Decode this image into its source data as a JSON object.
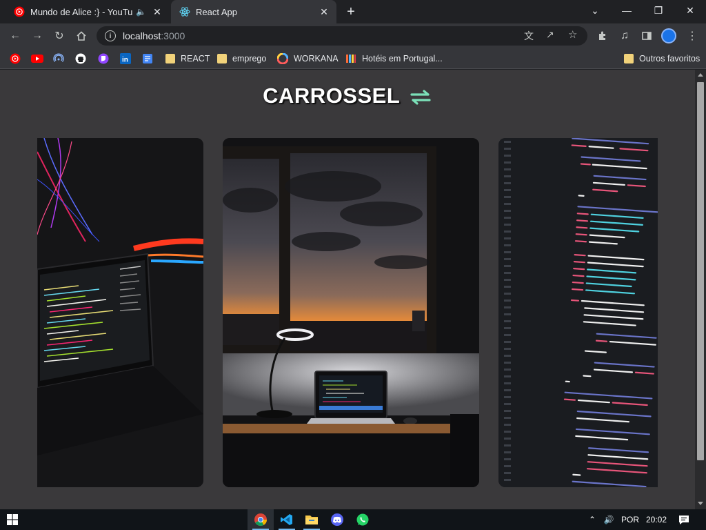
{
  "browser": {
    "tabs": [
      {
        "title": "Mundo de Alice :} - YouTube",
        "active": false,
        "audio": true
      },
      {
        "title": "React App",
        "active": true,
        "audio": false
      }
    ],
    "new_tab_label": "+",
    "window_controls": {
      "minimize": "—",
      "restore": "❐",
      "close": "✕"
    },
    "address": {
      "host": "localhost",
      "port": ":3000"
    },
    "bookmarks": [
      {
        "label": "",
        "icon": "youtube-music-icon"
      },
      {
        "label": "",
        "icon": "youtube-icon"
      },
      {
        "label": "",
        "icon": "podcast-icon"
      },
      {
        "label": "",
        "icon": "github-icon"
      },
      {
        "label": "",
        "icon": "twitch-icon"
      },
      {
        "label": "",
        "icon": "linkedin-icon"
      },
      {
        "label": "",
        "icon": "google-docs-icon"
      },
      {
        "label": "REACT",
        "icon": "folder-icon"
      },
      {
        "label": "emprego",
        "icon": "folder-icon"
      },
      {
        "label": "WORKANA",
        "icon": "workana-icon"
      },
      {
        "label": "Hotéis em Portugal...",
        "icon": "hotels-icon"
      }
    ],
    "other_bookmarks": "Outros favoritos"
  },
  "page": {
    "title": "CARROSSEL",
    "title_icon": "swap-arrows-icon",
    "accent": "#7be0b8",
    "cards": [
      {
        "name": "laptop-neon-image"
      },
      {
        "name": "window-sunset-laptop-image"
      },
      {
        "name": "code-screen-image"
      }
    ]
  },
  "taskbar": {
    "apps": [
      "chrome-icon",
      "vscode-icon",
      "file-explorer-icon",
      "discord-icon",
      "whatsapp-icon"
    ],
    "language": "POR",
    "time": "20:02"
  }
}
